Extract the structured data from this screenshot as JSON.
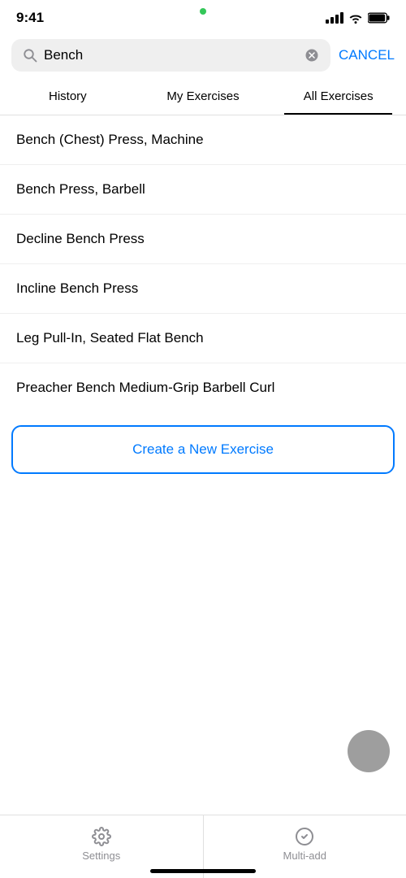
{
  "statusBar": {
    "time": "9:41",
    "greenDot": true
  },
  "searchBar": {
    "placeholder": "Bench",
    "value": "Bench",
    "clearButton": "×",
    "cancelLabel": "CANCEL"
  },
  "tabs": [
    {
      "id": "history",
      "label": "History",
      "active": false
    },
    {
      "id": "my-exercises",
      "label": "My Exercises",
      "active": false
    },
    {
      "id": "all-exercises",
      "label": "All Exercises",
      "active": true
    }
  ],
  "exercises": [
    {
      "id": 1,
      "name": "Bench (Chest) Press, Machine"
    },
    {
      "id": 2,
      "name": "Bench Press, Barbell"
    },
    {
      "id": 3,
      "name": "Decline Bench Press"
    },
    {
      "id": 4,
      "name": "Incline Bench Press"
    },
    {
      "id": 5,
      "name": "Leg Pull-In, Seated Flat Bench"
    },
    {
      "id": 6,
      "name": "Preacher Bench Medium-Grip Barbell Curl"
    }
  ],
  "createButton": {
    "label": "Create a New Exercise"
  },
  "bottomNav": [
    {
      "id": "settings",
      "label": "Settings",
      "icon": "gear"
    },
    {
      "id": "multi-add",
      "label": "Multi-add",
      "icon": "check-circle"
    }
  ]
}
